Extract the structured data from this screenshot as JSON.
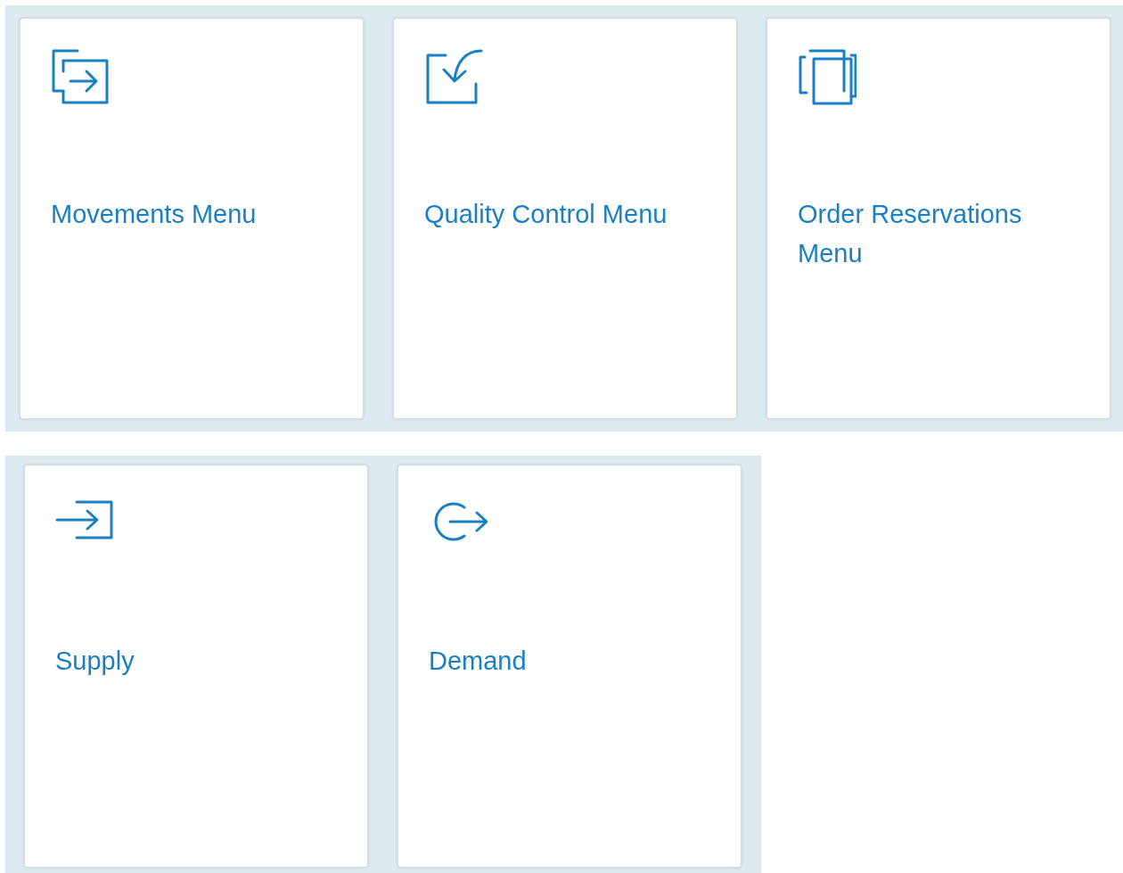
{
  "groups": [
    {
      "tiles": [
        {
          "title": "Movements Menu"
        },
        {
          "title": "Quality Control Menu"
        },
        {
          "title": "Order Reservations Menu"
        }
      ]
    },
    {
      "tiles": [
        {
          "title": "Supply"
        },
        {
          "title": "Demand"
        }
      ]
    }
  ]
}
